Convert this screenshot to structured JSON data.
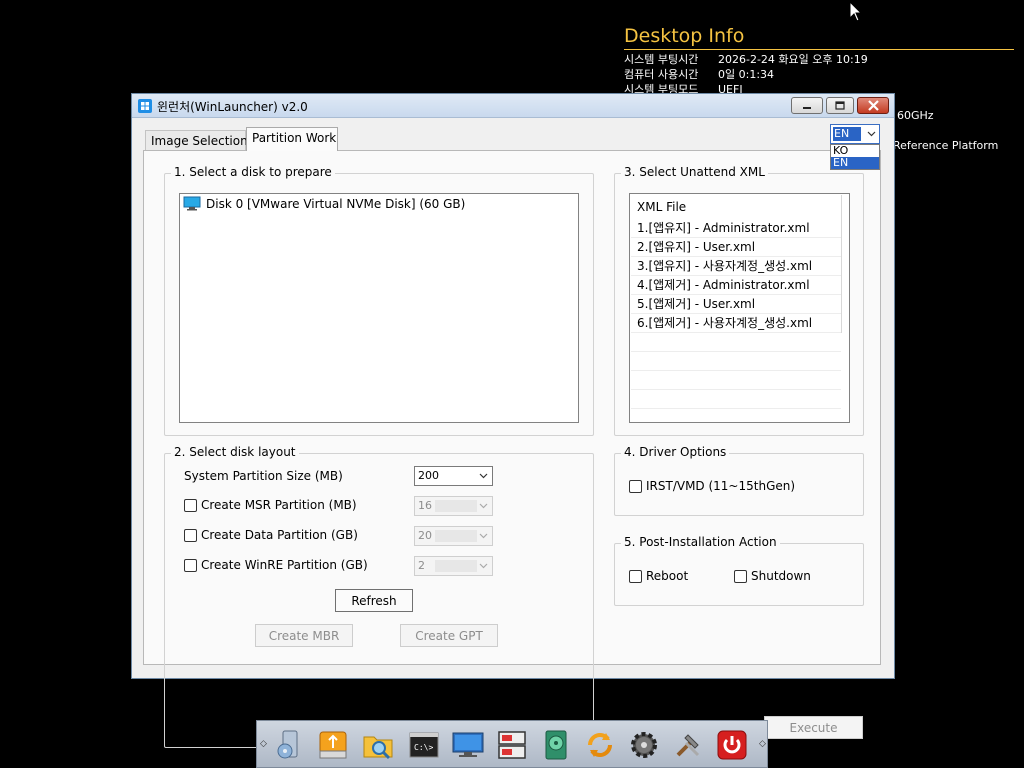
{
  "desktop_info": {
    "title": "Desktop Info",
    "rows": [
      {
        "key": "시스템 부팅시간",
        "value": "2026-2-24 화요일 오후 10:19"
      },
      {
        "key": "컴퓨터 사용시간",
        "value": "0일 0:1:34"
      },
      {
        "key": "시스템 부팅모드",
        "value": "UEFI"
      }
    ],
    "partial_cpu": "60GHz",
    "partial_platform": "Reference Platform"
  },
  "window": {
    "title": "윈런처(WinLauncher) v2.0",
    "tabs": [
      "Image Selection",
      "Partition Work"
    ],
    "language": {
      "selected": "EN",
      "options": [
        "KO",
        "EN"
      ]
    }
  },
  "disk_group": {
    "title": "1. Select a disk to prepare",
    "disks": [
      "Disk 0 [VMware Virtual NVMe Disk] (60 GB)"
    ]
  },
  "layout_group": {
    "title": "2. Select disk layout",
    "system_label": "System Partition Size (MB)",
    "system_value": "200",
    "msr_label": "Create MSR Partition (MB)",
    "msr_value": "16",
    "data_label": "Create Data Partition (GB)",
    "data_value": "20",
    "winre_label": "Create WinRE Partition (GB)",
    "winre_value": "2",
    "refresh": "Refresh",
    "create_mbr": "Create MBR",
    "create_gpt": "Create GPT"
  },
  "xml_group": {
    "title": "3. Select Unattend XML",
    "header": "XML File",
    "files": [
      "1.[앱유지] - Administrator.xml",
      "2.[앱유지] - User.xml",
      "3.[앱유지] - 사용자계정_생성.xml",
      "4.[앱제거] - Administrator.xml",
      "5.[앱제거] - User.xml",
      "6.[앱제거] - 사용자계정_생성.xml"
    ]
  },
  "driver_group": {
    "title": "4. Driver Options",
    "irst": "IRST/VMD (11~15thGen)"
  },
  "post_group": {
    "title": "5. Post-Installation Action",
    "reboot": "Reboot",
    "shutdown": "Shutdown",
    "execute": "Execute"
  },
  "taskbar": {
    "icons": [
      "disk-utility-icon",
      "usb-drive-icon",
      "folder-search-icon",
      "command-prompt-icon",
      "monitor-icon",
      "partition-tool-icon",
      "hdd-tool-icon",
      "sync-icon",
      "settings-icon",
      "tools-icon",
      "power-icon"
    ]
  }
}
